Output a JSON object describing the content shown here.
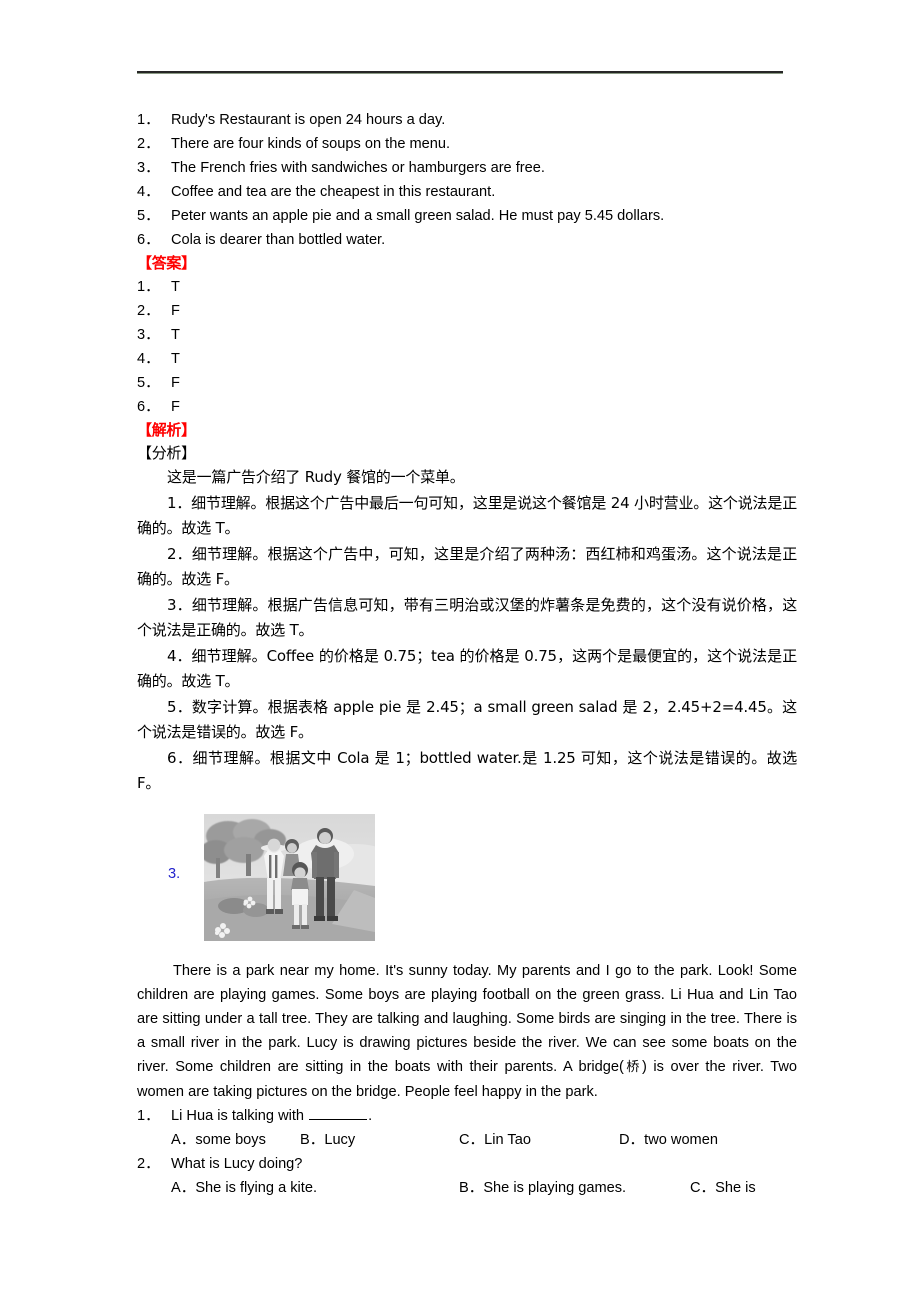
{
  "document": {
    "statements_heading": "",
    "statements": [
      {
        "num": "1．",
        "text": "Rudy's Restaurant is open 24 hours a day."
      },
      {
        "num": "2．",
        "text": "There are four kinds of soups on the menu."
      },
      {
        "num": "3．",
        "text": "The French fries with sandwiches or hamburgers are free."
      },
      {
        "num": "4．",
        "text": "Coffee and tea are the cheapest in this restaurant."
      },
      {
        "num": "5．",
        "text": "Peter wants an apple pie and a small green salad. He must pay 5.45 dollars."
      },
      {
        "num": "6．",
        "text": "Cola is dearer than bottled water."
      }
    ],
    "answer_heading": "【答案】",
    "answers": [
      {
        "num": "1．",
        "value": "T"
      },
      {
        "num": "2．",
        "value": "F"
      },
      {
        "num": "3．",
        "value": "T"
      },
      {
        "num": "4．",
        "value": "T"
      },
      {
        "num": "5．",
        "value": "F"
      },
      {
        "num": "6．",
        "value": "F"
      }
    ],
    "explanation_heading": "【解析】",
    "analysis_heading": "【分析】",
    "analysis_intro": "这是一篇广告介绍了 Rudy 餐馆的一个菜单。",
    "explanations": [
      "1．细节理解。根据这个广告中最后一句可知，这里是说这个餐馆是 24 小时营业。这个说法是正确的。故选 T。",
      "2．细节理解。根据这个广告中，可知，这里是介绍了两种汤：西红柿和鸡蛋汤。这个说法是正确的。故选 F。",
      "3．细节理解。根据广告信息可知，带有三明治或汉堡的炸薯条是免费的，这个没有说价格，这个说法是正确的。故选 T。",
      "4．细节理解。Coffee 的价格是 0.75；tea 的价格是 0.75，这两个是最便宜的，这个说法是正确的。故选 T。",
      "5．数字计算。根据表格 apple pie 是 2.45；a small green salad 是 2，2.45+2=4.45。这个说法是错误的。故选 F。",
      "6．细节理解。根据文中 Cola 是 1；bottled water.是 1.25 可知，这个说法是错误的。故选 F。"
    ],
    "figure": {
      "number": "3.",
      "alt": "park-family-illustration"
    },
    "passage": "There is a park near my home. It's sunny today. My parents and I go to the park. Look! Some children are playing games. Some boys are playing football on the green grass. Li Hua and Lin Tao are sitting under a tall tree. They are talking and laughing. Some birds are singing in the tree. There is a small river in the park. Lucy is drawing pictures beside the river. We can see some boats on the river. Some children are sitting in the boats with their parents. A bridge(桥) is over the river. Two women are taking pictures on the bridge. People feel happy in the park.",
    "passage_parts": {
      "before_cn": "There is a park near my home. It's sunny today. My parents and I go to the park. Look! Some children are playing games. Some boys are playing football on the green grass. Li Hua and Lin Tao are sitting under a tall tree. They are talking and laughing. Some birds are singing in the tree. There is a small river in the park. Lucy is drawing pictures beside the river. We can see some boats on the river. Some children are sitting in the boats with their parents. A bridge(",
      "cn": "桥",
      "after_cn": ") is over the river. Two women are taking pictures on the bridge. People feel happy in the park."
    },
    "questions": [
      {
        "num": "1．",
        "stem_before_blank": "Li Hua is talking with ",
        "stem_after_blank": ".",
        "options": [
          {
            "label": "A．",
            "text": "some boys"
          },
          {
            "label": "B．",
            "text": "Lucy"
          },
          {
            "label": "C．",
            "text": "Lin Tao"
          },
          {
            "label": "D．",
            "text": "two women"
          }
        ]
      },
      {
        "num": "2．",
        "stem": "What is Lucy doing?",
        "options": [
          {
            "label": "A．",
            "text": "She is flying a kite."
          },
          {
            "label": "B．",
            "text": "She is playing games."
          },
          {
            "label": "C．",
            "text": "She is"
          }
        ]
      }
    ],
    "colors": {
      "heading_red": "#ff0000",
      "figure_number_blue": "#2222cc",
      "rule_dark": "#262626",
      "rule_light": "#8a9a84",
      "text": "#000000"
    }
  }
}
